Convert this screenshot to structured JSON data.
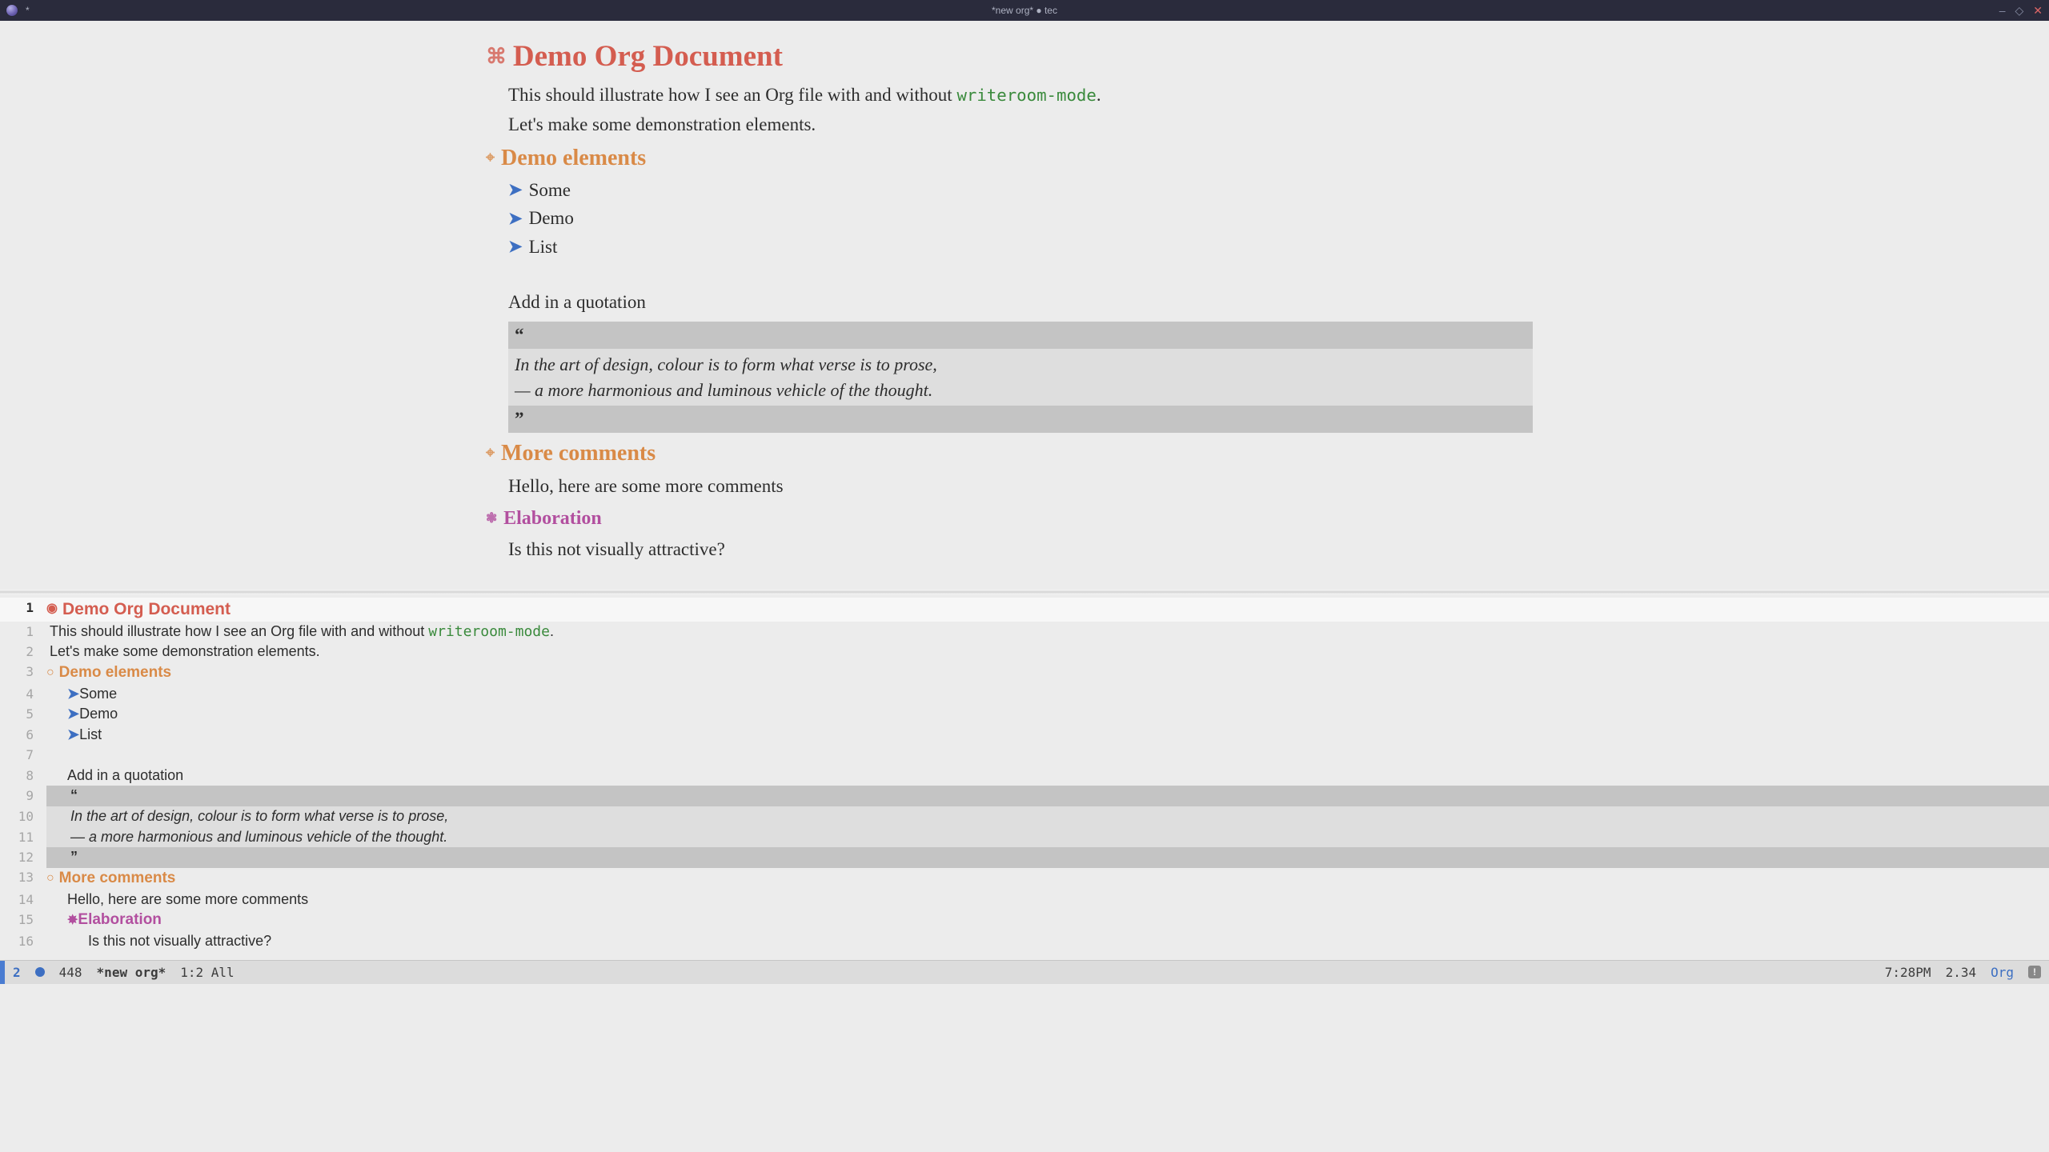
{
  "titlebar": {
    "title": "*new org* ● tec",
    "left_star": "*"
  },
  "top": {
    "h1_icon": "⌘",
    "h1": "Demo Org Document",
    "intro_a": "This should illustrate how I see an Org file with and without ",
    "intro_code": "writeroom-mode",
    "intro_b": ".",
    "intro2": "Let's make some demonstration elements.",
    "h2_icon": "⌖",
    "h2": "Demo elements",
    "list": [
      "Some",
      "Demo",
      "List"
    ],
    "addquote": "Add in a quotation",
    "qopen": "“",
    "q1": "In the art of design, colour is to form what verse is to prose,",
    "q2": "— a more harmonious and luminous vehicle of the thought.",
    "qclose": "”",
    "h2b": "More comments",
    "hello": "Hello, here are some more comments",
    "h3_icon": "❃",
    "h3": "Elaboration",
    "attractive": "Is this not visually attractive?"
  },
  "bottom": {
    "h1_icon": "◉",
    "h2_icon": "○",
    "h3_icon": "✸",
    "lines": [
      {
        "n": "1",
        "bold": true,
        "hi": true
      },
      {
        "n": "1"
      },
      {
        "n": "2"
      },
      {
        "n": "3"
      },
      {
        "n": "4"
      },
      {
        "n": "5"
      },
      {
        "n": "6"
      },
      {
        "n": "7"
      },
      {
        "n": "8"
      },
      {
        "n": "9"
      },
      {
        "n": "10"
      },
      {
        "n": "11"
      },
      {
        "n": "12"
      },
      {
        "n": "13"
      },
      {
        "n": "14"
      },
      {
        "n": "15"
      },
      {
        "n": "16"
      }
    ]
  },
  "modeline": {
    "winnum": "2",
    "count": "448",
    "buf": "*new org*",
    "pos": "1:2 All",
    "time": "7:28PM",
    "load": "2.34",
    "mode": "Org",
    "excl": "!"
  }
}
